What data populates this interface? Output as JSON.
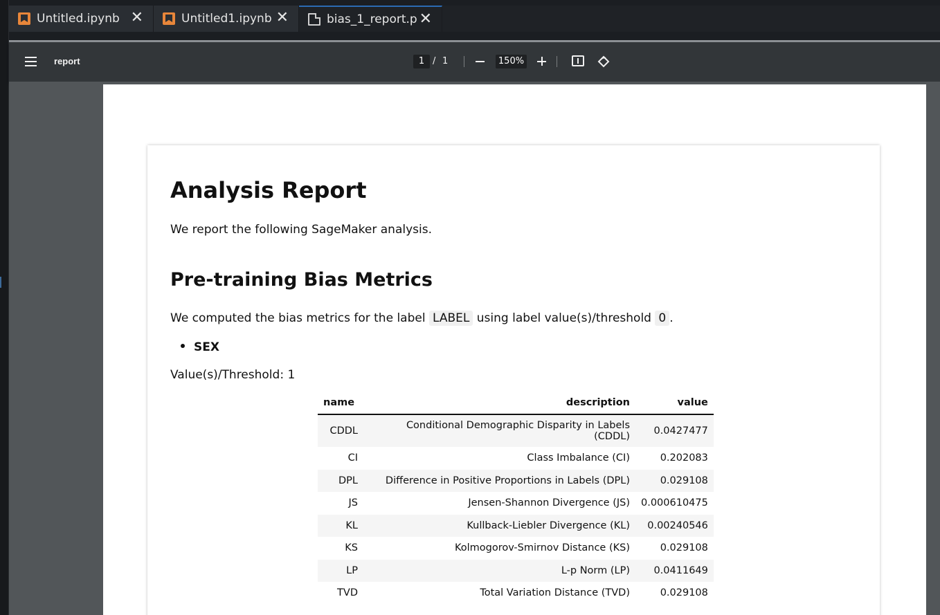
{
  "tabs": [
    {
      "label": "Untitled.ipynb",
      "icon": "notebook-icon"
    },
    {
      "label": "Untitled1.ipynb",
      "icon": "notebook-icon"
    },
    {
      "label": "bias_1_report.p",
      "icon": "document-icon"
    }
  ],
  "toolbar": {
    "title": "report",
    "current_page": "1",
    "page_separator": "/",
    "total_pages": "1",
    "zoom": "150%"
  },
  "report": {
    "title": "Analysis Report",
    "intro": "We report the following SageMaker analysis.",
    "section_title": "Pre-training Bias Metrics",
    "computed_prefix": "We computed the bias metrics for the label",
    "label_code": "LABEL",
    "computed_middle": "using label value(s)/threshold",
    "threshold_code": "0",
    "computed_suffix": ".",
    "facet": "SEX",
    "threshold_line": "Value(s)/Threshold: 1"
  },
  "table": {
    "headers": [
      "name",
      "description",
      "value"
    ],
    "rows": [
      [
        "CDDL",
        "Conditional Demographic Disparity in Labels (CDDL)",
        "0.0427477"
      ],
      [
        "CI",
        "Class Imbalance (CI)",
        "0.202083"
      ],
      [
        "DPL",
        "Difference in Positive Proportions in Labels (DPL)",
        "0.029108"
      ],
      [
        "JS",
        "Jensen-Shannon Divergence (JS)",
        "0.000610475"
      ],
      [
        "KL",
        "Kullback-Liebler Divergence (KL)",
        "0.00240546"
      ],
      [
        "KS",
        "Kolmogorov-Smirnov Distance (KS)",
        "0.029108"
      ],
      [
        "LP",
        "L-p Norm (LP)",
        "0.0411649"
      ],
      [
        "TVD",
        "Total Variation Distance (TVD)",
        "0.029108"
      ]
    ]
  },
  "colors": {
    "toolbar_bg": "#323639",
    "viewer_bg": "#525659",
    "notebook_icon": "#e8863a",
    "active_tab_accent": "#2b6bb3"
  }
}
